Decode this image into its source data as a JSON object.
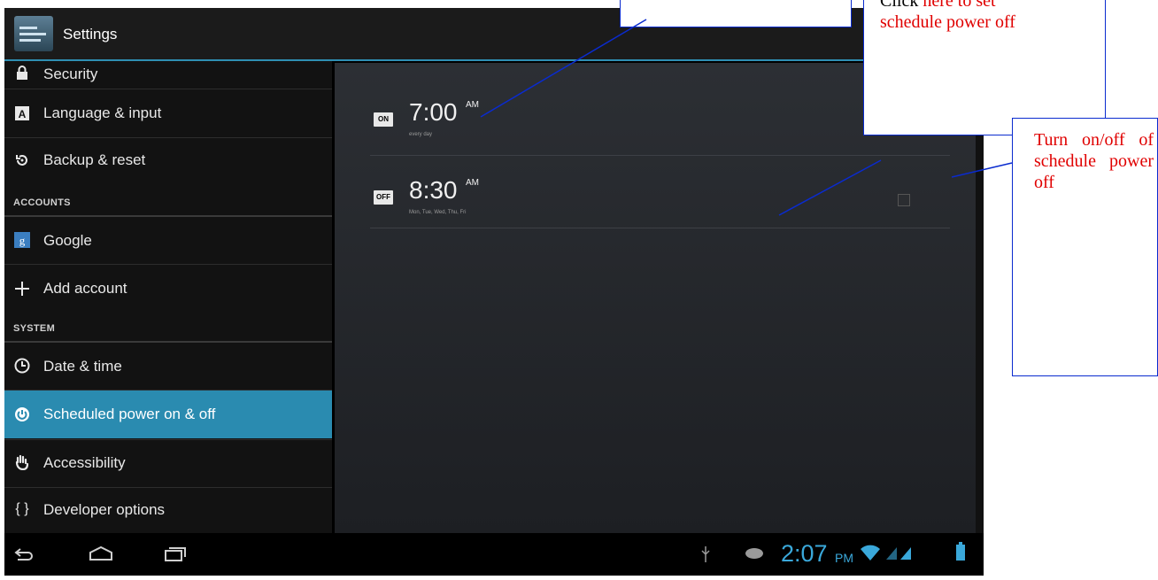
{
  "app": {
    "title": "Settings"
  },
  "sidebar": {
    "items": [
      {
        "label": "Security",
        "icon": "lock-icon"
      },
      {
        "label": "Language & input",
        "icon": "keyboard-a-icon"
      },
      {
        "label": "Backup & reset",
        "icon": "restore-icon"
      }
    ],
    "accounts_header": "ACCOUNTS",
    "accounts": [
      {
        "label": "Google",
        "icon": "google-icon"
      },
      {
        "label": "Add account",
        "icon": "plus-icon"
      }
    ],
    "system_header": "SYSTEM",
    "system": [
      {
        "label": "Date & time",
        "icon": "clock-icon"
      },
      {
        "label": "Scheduled power on & off",
        "icon": "power-schedule-icon",
        "selected": true
      },
      {
        "label": "Accessibility",
        "icon": "hand-icon"
      },
      {
        "label": "Developer options",
        "icon": "braces-icon"
      }
    ]
  },
  "schedules": [
    {
      "state": "ON",
      "time": "7:00",
      "ampm": "AM",
      "days": "every day"
    },
    {
      "state": "OFF",
      "time": "8:30",
      "ampm": "AM",
      "days": "Mon, Tue, Wed, Thu, Fri",
      "checked": false
    }
  ],
  "navbar": {
    "icons": [
      "back-icon",
      "home-icon",
      "recent-apps-icon"
    ],
    "status_icons": [
      "usb-icon",
      "gamepad-icon",
      "wifi-icon",
      "signal-icon",
      "battery-icon"
    ],
    "clock": "2:07",
    "clock_ampm": "PM"
  },
  "annotations": {
    "top_right_black": "Click ",
    "top_right_red": "here to set",
    "top_right_line2": "schedule power off",
    "right_box": "Turn on/off of schedule power off"
  },
  "colors": {
    "accent": "#2a8bb0",
    "clock": "#3aa8da",
    "annotation_red": "#e00000",
    "annotation_border": "#0a2bcf"
  }
}
